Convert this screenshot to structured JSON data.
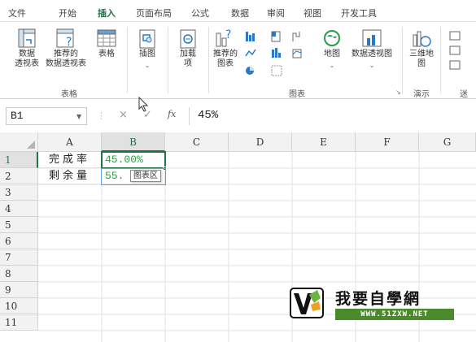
{
  "menu": {
    "tabs": [
      "文件",
      "开始",
      "插入",
      "页面布局",
      "公式",
      "数据",
      "审阅",
      "视图",
      "开发工具"
    ],
    "active": "插入"
  },
  "ribbon": {
    "tables": {
      "pivot_label1": "数据",
      "pivot_label2": "透视表",
      "rec_pivot_label1": "推荐的",
      "rec_pivot_label2": "数据透视表",
      "table_label": "表格",
      "group_label": "表格"
    },
    "illustrations": {
      "label": "插图"
    },
    "addins": {
      "label1": "加载",
      "label2": "项"
    },
    "charts": {
      "rec_label1": "推荐的",
      "rec_label2": "图表",
      "map_label": "地图",
      "pivotchart_label": "数据透视图",
      "group_label": "图表"
    },
    "tours": {
      "label1": "三维地",
      "label2": "图",
      "group_label": "演示"
    },
    "sparklines": {
      "group_label": "迷"
    }
  },
  "formula_bar": {
    "name_box": "B1",
    "fx_symbol": "fx",
    "cancel_symbol": "×",
    "enter_symbol": "✓",
    "content": "45%"
  },
  "grid": {
    "columns": [
      "A",
      "B",
      "C",
      "D",
      "E",
      "F",
      "G"
    ],
    "rows": [
      "1",
      "2",
      "3",
      "4",
      "5",
      "6",
      "7",
      "8",
      "9",
      "10",
      "11"
    ],
    "cells": {
      "A1": "完成率",
      "B1": "45.00%",
      "A2": "剩余量",
      "B2": "55."
    },
    "selected_cell": "B1",
    "tooltip": "图表区"
  },
  "watermark": {
    "title": "我要自學網",
    "url": "WWW.51ZXW.NET"
  },
  "colors": {
    "accent": "#217346",
    "value_green": "#2aa04a"
  }
}
